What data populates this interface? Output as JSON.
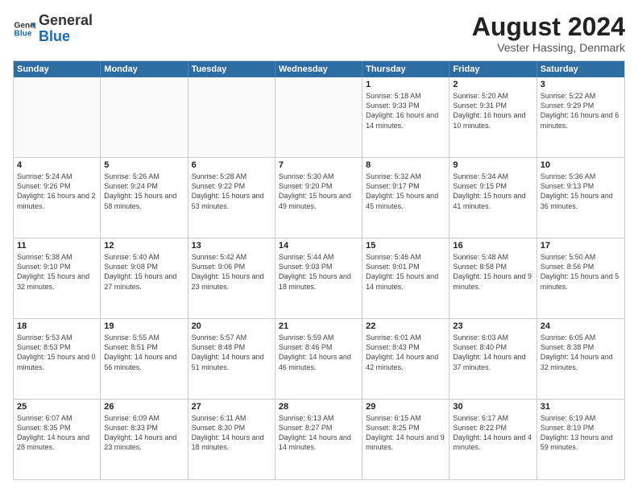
{
  "logo": {
    "line1": "General",
    "line2": "Blue"
  },
  "title": "August 2024",
  "subtitle": "Vester Hassing, Denmark",
  "header": {
    "days": [
      "Sunday",
      "Monday",
      "Tuesday",
      "Wednesday",
      "Thursday",
      "Friday",
      "Saturday"
    ]
  },
  "rows": [
    [
      {
        "day": "",
        "sunrise": "",
        "sunset": "",
        "daylight": ""
      },
      {
        "day": "",
        "sunrise": "",
        "sunset": "",
        "daylight": ""
      },
      {
        "day": "",
        "sunrise": "",
        "sunset": "",
        "daylight": ""
      },
      {
        "day": "",
        "sunrise": "",
        "sunset": "",
        "daylight": ""
      },
      {
        "day": "1",
        "sunrise": "Sunrise: 5:18 AM",
        "sunset": "Sunset: 9:33 PM",
        "daylight": "Daylight: 16 hours and 14 minutes."
      },
      {
        "day": "2",
        "sunrise": "Sunrise: 5:20 AM",
        "sunset": "Sunset: 9:31 PM",
        "daylight": "Daylight: 16 hours and 10 minutes."
      },
      {
        "day": "3",
        "sunrise": "Sunrise: 5:22 AM",
        "sunset": "Sunset: 9:29 PM",
        "daylight": "Daylight: 16 hours and 6 minutes."
      }
    ],
    [
      {
        "day": "4",
        "sunrise": "Sunrise: 5:24 AM",
        "sunset": "Sunset: 9:26 PM",
        "daylight": "Daylight: 16 hours and 2 minutes."
      },
      {
        "day": "5",
        "sunrise": "Sunrise: 5:26 AM",
        "sunset": "Sunset: 9:24 PM",
        "daylight": "Daylight: 15 hours and 58 minutes."
      },
      {
        "day": "6",
        "sunrise": "Sunrise: 5:28 AM",
        "sunset": "Sunset: 9:22 PM",
        "daylight": "Daylight: 15 hours and 53 minutes."
      },
      {
        "day": "7",
        "sunrise": "Sunrise: 5:30 AM",
        "sunset": "Sunset: 9:20 PM",
        "daylight": "Daylight: 15 hours and 49 minutes."
      },
      {
        "day": "8",
        "sunrise": "Sunrise: 5:32 AM",
        "sunset": "Sunset: 9:17 PM",
        "daylight": "Daylight: 15 hours and 45 minutes."
      },
      {
        "day": "9",
        "sunrise": "Sunrise: 5:34 AM",
        "sunset": "Sunset: 9:15 PM",
        "daylight": "Daylight: 15 hours and 41 minutes."
      },
      {
        "day": "10",
        "sunrise": "Sunrise: 5:36 AM",
        "sunset": "Sunset: 9:13 PM",
        "daylight": "Daylight: 15 hours and 36 minutes."
      }
    ],
    [
      {
        "day": "11",
        "sunrise": "Sunrise: 5:38 AM",
        "sunset": "Sunset: 9:10 PM",
        "daylight": "Daylight: 15 hours and 32 minutes."
      },
      {
        "day": "12",
        "sunrise": "Sunrise: 5:40 AM",
        "sunset": "Sunset: 9:08 PM",
        "daylight": "Daylight: 15 hours and 27 minutes."
      },
      {
        "day": "13",
        "sunrise": "Sunrise: 5:42 AM",
        "sunset": "Sunset: 9:06 PM",
        "daylight": "Daylight: 15 hours and 23 minutes."
      },
      {
        "day": "14",
        "sunrise": "Sunrise: 5:44 AM",
        "sunset": "Sunset: 9:03 PM",
        "daylight": "Daylight: 15 hours and 18 minutes."
      },
      {
        "day": "15",
        "sunrise": "Sunrise: 5:46 AM",
        "sunset": "Sunset: 9:01 PM",
        "daylight": "Daylight: 15 hours and 14 minutes."
      },
      {
        "day": "16",
        "sunrise": "Sunrise: 5:48 AM",
        "sunset": "Sunset: 8:58 PM",
        "daylight": "Daylight: 15 hours and 9 minutes."
      },
      {
        "day": "17",
        "sunrise": "Sunrise: 5:50 AM",
        "sunset": "Sunset: 8:56 PM",
        "daylight": "Daylight: 15 hours and 5 minutes."
      }
    ],
    [
      {
        "day": "18",
        "sunrise": "Sunrise: 5:53 AM",
        "sunset": "Sunset: 8:53 PM",
        "daylight": "Daylight: 15 hours and 0 minutes."
      },
      {
        "day": "19",
        "sunrise": "Sunrise: 5:55 AM",
        "sunset": "Sunset: 8:51 PM",
        "daylight": "Daylight: 14 hours and 56 minutes."
      },
      {
        "day": "20",
        "sunrise": "Sunrise: 5:57 AM",
        "sunset": "Sunset: 8:48 PM",
        "daylight": "Daylight: 14 hours and 51 minutes."
      },
      {
        "day": "21",
        "sunrise": "Sunrise: 5:59 AM",
        "sunset": "Sunset: 8:46 PM",
        "daylight": "Daylight: 14 hours and 46 minutes."
      },
      {
        "day": "22",
        "sunrise": "Sunrise: 6:01 AM",
        "sunset": "Sunset: 8:43 PM",
        "daylight": "Daylight: 14 hours and 42 minutes."
      },
      {
        "day": "23",
        "sunrise": "Sunrise: 6:03 AM",
        "sunset": "Sunset: 8:40 PM",
        "daylight": "Daylight: 14 hours and 37 minutes."
      },
      {
        "day": "24",
        "sunrise": "Sunrise: 6:05 AM",
        "sunset": "Sunset: 8:38 PM",
        "daylight": "Daylight: 14 hours and 32 minutes."
      }
    ],
    [
      {
        "day": "25",
        "sunrise": "Sunrise: 6:07 AM",
        "sunset": "Sunset: 8:35 PM",
        "daylight": "Daylight: 14 hours and 28 minutes."
      },
      {
        "day": "26",
        "sunrise": "Sunrise: 6:09 AM",
        "sunset": "Sunset: 8:33 PM",
        "daylight": "Daylight: 14 hours and 23 minutes."
      },
      {
        "day": "27",
        "sunrise": "Sunrise: 6:11 AM",
        "sunset": "Sunset: 8:30 PM",
        "daylight": "Daylight: 14 hours and 18 minutes."
      },
      {
        "day": "28",
        "sunrise": "Sunrise: 6:13 AM",
        "sunset": "Sunset: 8:27 PM",
        "daylight": "Daylight: 14 hours and 14 minutes."
      },
      {
        "day": "29",
        "sunrise": "Sunrise: 6:15 AM",
        "sunset": "Sunset: 8:25 PM",
        "daylight": "Daylight: 14 hours and 9 minutes."
      },
      {
        "day": "30",
        "sunrise": "Sunrise: 6:17 AM",
        "sunset": "Sunset: 8:22 PM",
        "daylight": "Daylight: 14 hours and 4 minutes."
      },
      {
        "day": "31",
        "sunrise": "Sunrise: 6:19 AM",
        "sunset": "Sunset: 8:19 PM",
        "daylight": "Daylight: 13 hours and 59 minutes."
      }
    ]
  ]
}
